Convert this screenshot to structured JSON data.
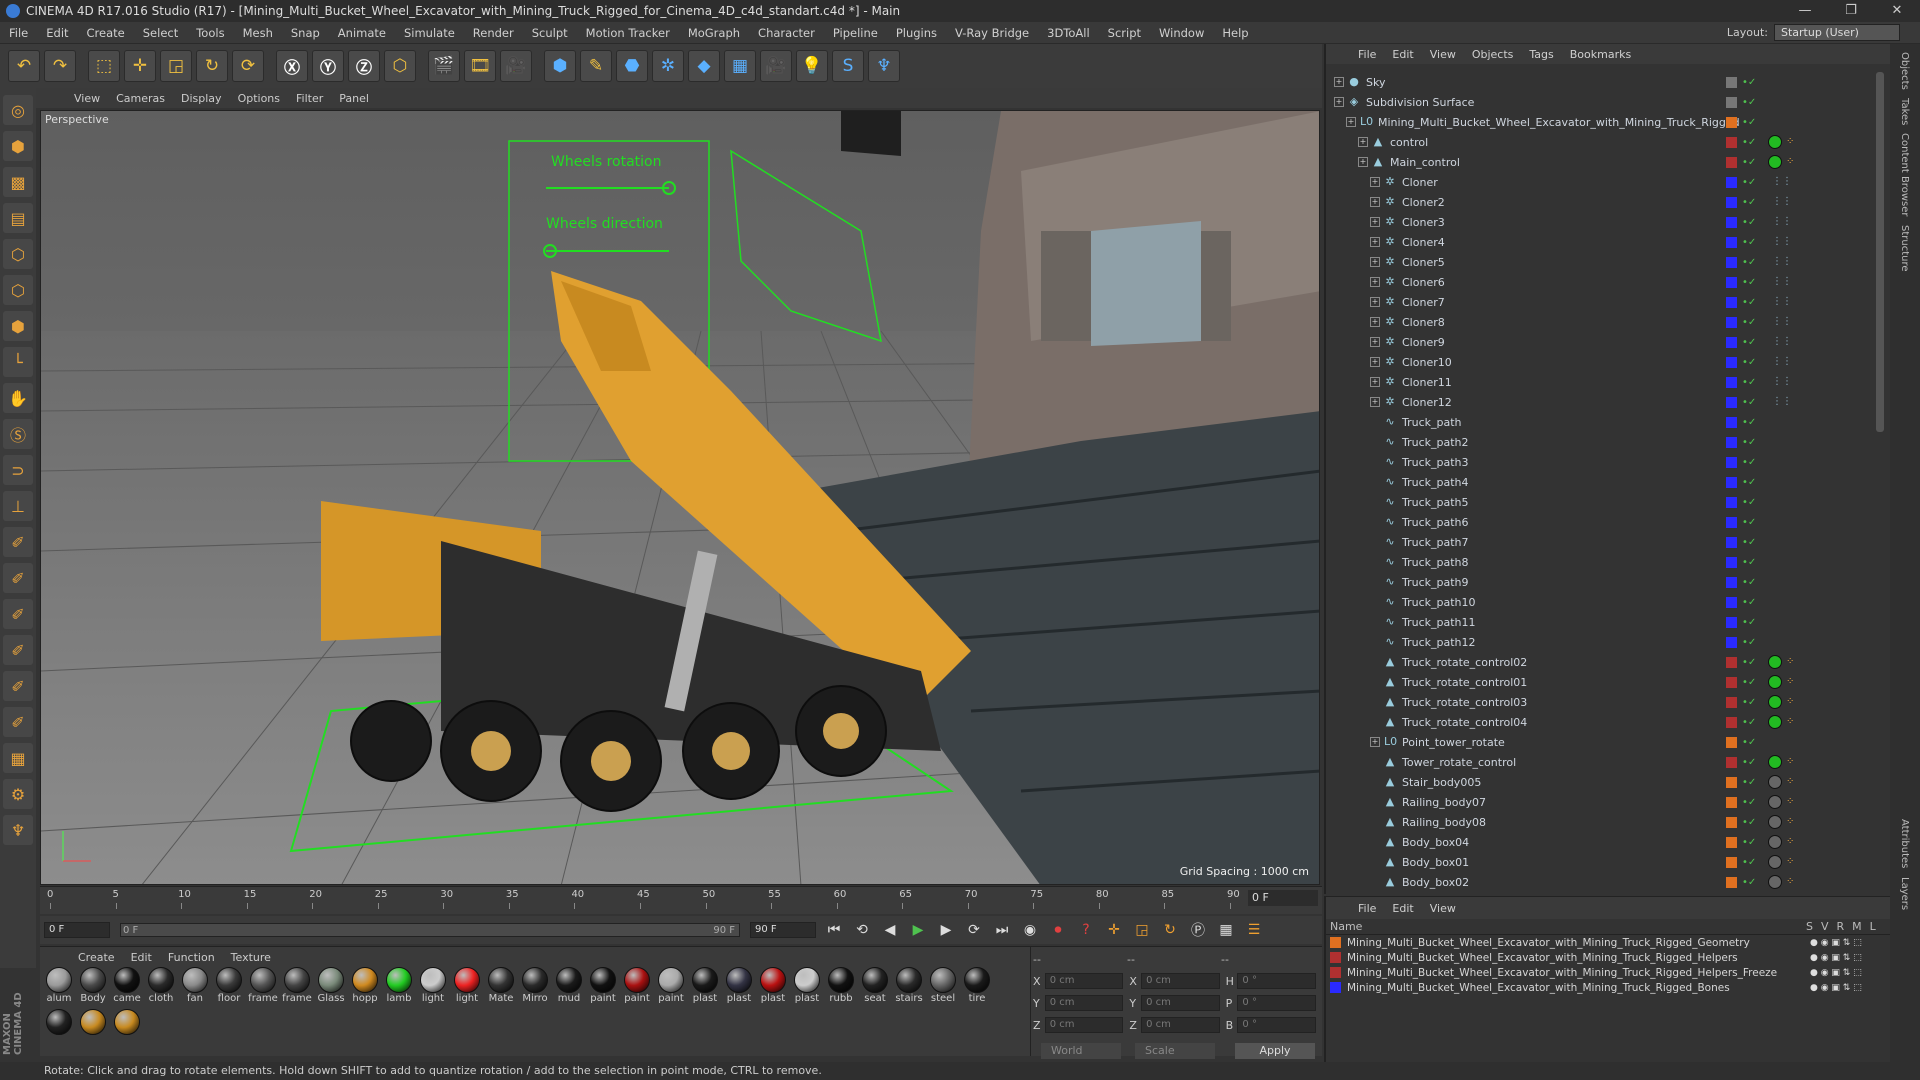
{
  "window": {
    "title": "CINEMA 4D R17.016 Studio (R17) - [Mining_Multi_Bucket_Wheel_Excavator_with_Mining_Truck_Rigged_for_Cinema_4D_c4d_standart.c4d *] - Main",
    "controls": [
      "—",
      "❐",
      "✕"
    ]
  },
  "menu": [
    "File",
    "Edit",
    "Create",
    "Select",
    "Tools",
    "Mesh",
    "Snap",
    "Animate",
    "Simulate",
    "Render",
    "Sculpt",
    "Motion Tracker",
    "MoGraph",
    "Character",
    "Pipeline",
    "Plugins",
    "V-Ray Bridge",
    "3DToAll",
    "Script",
    "Window",
    "Help"
  ],
  "layout": {
    "label": "Layout:",
    "value": "Startup (User)"
  },
  "viewport": {
    "menu": [
      "View",
      "Cameras",
      "Display",
      "Options",
      "Filter",
      "Panel"
    ],
    "label": "Perspective",
    "grid_spacing": "Grid Spacing : 1000 cm",
    "hud": [
      "Wheels rotation",
      "Wheels direction"
    ]
  },
  "timeline": {
    "ticks": [
      "0",
      "5",
      "10",
      "15",
      "20",
      "25",
      "30",
      "35",
      "40",
      "45",
      "50",
      "55",
      "60",
      "65",
      "70",
      "75",
      "80",
      "85",
      "90"
    ],
    "frame_end": "0 F"
  },
  "transport": {
    "start": "0 F",
    "scrub_start": "0 F",
    "scrub_end": "90 F",
    "end": "90 F"
  },
  "material": {
    "menu": [
      "Create",
      "Edit",
      "Function",
      "Texture"
    ],
    "items": [
      {
        "label": "alum",
        "color": "#9a9a9a"
      },
      {
        "label": "Body",
        "color": "#4a4a4a"
      },
      {
        "label": "came",
        "color": "#111111"
      },
      {
        "label": "cloth",
        "color": "#2a2a2a"
      },
      {
        "label": "fan",
        "color": "#8a8a8a"
      },
      {
        "label": "floor",
        "color": "#3a3a3a"
      },
      {
        "label": "frame",
        "color": "#555555"
      },
      {
        "label": "frame",
        "color": "#444444"
      },
      {
        "label": "Glass",
        "color": "#7a8a7a"
      },
      {
        "label": "hopp",
        "color": "#d08a20"
      },
      {
        "label": "lamb",
        "color": "#22cc22"
      },
      {
        "label": "light",
        "color": "#cccccc"
      },
      {
        "label": "light",
        "color": "#ee2222"
      },
      {
        "label": "Mate",
        "color": "#333333"
      },
      {
        "label": "Mirro",
        "color": "#2a2a2a"
      },
      {
        "label": "mud",
        "color": "#1a1a1a"
      },
      {
        "label": "paint",
        "color": "#111111"
      },
      {
        "label": "paint",
        "color": "#aa1111"
      },
      {
        "label": "paint",
        "color": "#aaaaaa"
      },
      {
        "label": "plast",
        "color": "#1a1a1a"
      },
      {
        "label": "plast",
        "color": "#333344"
      },
      {
        "label": "plast",
        "color": "#bb1111"
      },
      {
        "label": "plast",
        "color": "#cccccc"
      },
      {
        "label": "rubb",
        "color": "#111111"
      },
      {
        "label": "seat",
        "color": "#222222"
      },
      {
        "label": "stairs",
        "color": "#2a2a2a"
      },
      {
        "label": "steel",
        "color": "#666666"
      },
      {
        "label": "tire",
        "color": "#1a1a1a"
      },
      {
        "label": "",
        "color": "#222222"
      },
      {
        "label": "",
        "color": "#c88a20"
      },
      {
        "label": "",
        "color": "#c88a20"
      }
    ]
  },
  "coords": {
    "header": [
      "--",
      "--",
      "--"
    ],
    "rows": [
      {
        "a": "X",
        "v1": "0 cm",
        "b": "X",
        "v2": "0 cm",
        "c": "H",
        "v3": "0 °"
      },
      {
        "a": "Y",
        "v1": "0 cm",
        "b": "Y",
        "v2": "0 cm",
        "c": "P",
        "v3": "0 °"
      },
      {
        "a": "Z",
        "v1": "0 cm",
        "b": "Z",
        "v2": "0 cm",
        "c": "B",
        "v3": "0 °"
      }
    ],
    "mode": "World",
    "scale": "Scale",
    "apply": "Apply"
  },
  "objects": {
    "menu": [
      "File",
      "Edit",
      "View",
      "Objects",
      "Tags",
      "Bookmarks"
    ],
    "rows": [
      {
        "name": "Sky",
        "indent": 0,
        "icon": "●",
        "color": "#777",
        "tag": ""
      },
      {
        "name": "Subdivision Surface",
        "indent": 0,
        "icon": "◈",
        "color": "#777",
        "tag": ""
      },
      {
        "name": "Mining_Multi_Bucket_Wheel_Excavator_with_Mining_Truck_Rigged",
        "indent": 1,
        "icon": "L0",
        "color": "#e07020",
        "tag": ""
      },
      {
        "name": "control",
        "indent": 2,
        "icon": "▲",
        "color": "#b03030",
        "tag": "#22bb22"
      },
      {
        "name": "Main_control",
        "indent": 2,
        "icon": "▲",
        "color": "#b03030",
        "tag": "#22bb22"
      },
      {
        "name": "Cloner",
        "indent": 3,
        "icon": "✲",
        "color": "#2a2aff",
        "tag": ""
      },
      {
        "name": "Cloner2",
        "indent": 3,
        "icon": "✲",
        "color": "#2a2aff",
        "tag": ""
      },
      {
        "name": "Cloner3",
        "indent": 3,
        "icon": "✲",
        "color": "#2a2aff",
        "tag": ""
      },
      {
        "name": "Cloner4",
        "indent": 3,
        "icon": "✲",
        "color": "#2a2aff",
        "tag": ""
      },
      {
        "name": "Cloner5",
        "indent": 3,
        "icon": "✲",
        "color": "#2a2aff",
        "tag": ""
      },
      {
        "name": "Cloner6",
        "indent": 3,
        "icon": "✲",
        "color": "#2a2aff",
        "tag": ""
      },
      {
        "name": "Cloner7",
        "indent": 3,
        "icon": "✲",
        "color": "#2a2aff",
        "tag": ""
      },
      {
        "name": "Cloner8",
        "indent": 3,
        "icon": "✲",
        "color": "#2a2aff",
        "tag": ""
      },
      {
        "name": "Cloner9",
        "indent": 3,
        "icon": "✲",
        "color": "#2a2aff",
        "tag": ""
      },
      {
        "name": "Cloner10",
        "indent": 3,
        "icon": "✲",
        "color": "#2a2aff",
        "tag": ""
      },
      {
        "name": "Cloner11",
        "indent": 3,
        "icon": "✲",
        "color": "#2a2aff",
        "tag": ""
      },
      {
        "name": "Cloner12",
        "indent": 3,
        "icon": "✲",
        "color": "#2a2aff",
        "tag": ""
      },
      {
        "name": "Truck_path",
        "indent": 3,
        "icon": "∿",
        "color": "#2a2aff",
        "tag": ""
      },
      {
        "name": "Truck_path2",
        "indent": 3,
        "icon": "∿",
        "color": "#2a2aff",
        "tag": ""
      },
      {
        "name": "Truck_path3",
        "indent": 3,
        "icon": "∿",
        "color": "#2a2aff",
        "tag": ""
      },
      {
        "name": "Truck_path4",
        "indent": 3,
        "icon": "∿",
        "color": "#2a2aff",
        "tag": ""
      },
      {
        "name": "Truck_path5",
        "indent": 3,
        "icon": "∿",
        "color": "#2a2aff",
        "tag": ""
      },
      {
        "name": "Truck_path6",
        "indent": 3,
        "icon": "∿",
        "color": "#2a2aff",
        "tag": ""
      },
      {
        "name": "Truck_path7",
        "indent": 3,
        "icon": "∿",
        "color": "#2a2aff",
        "tag": ""
      },
      {
        "name": "Truck_path8",
        "indent": 3,
        "icon": "∿",
        "color": "#2a2aff",
        "tag": ""
      },
      {
        "name": "Truck_path9",
        "indent": 3,
        "icon": "∿",
        "color": "#2a2aff",
        "tag": ""
      },
      {
        "name": "Truck_path10",
        "indent": 3,
        "icon": "∿",
        "color": "#2a2aff",
        "tag": ""
      },
      {
        "name": "Truck_path11",
        "indent": 3,
        "icon": "∿",
        "color": "#2a2aff",
        "tag": ""
      },
      {
        "name": "Truck_path12",
        "indent": 3,
        "icon": "∿",
        "color": "#2a2aff",
        "tag": ""
      },
      {
        "name": "Truck_rotate_control02",
        "indent": 3,
        "icon": "▲",
        "color": "#b03030",
        "tag": "#22bb22"
      },
      {
        "name": "Truck_rotate_control01",
        "indent": 3,
        "icon": "▲",
        "color": "#b03030",
        "tag": "#22bb22"
      },
      {
        "name": "Truck_rotate_control03",
        "indent": 3,
        "icon": "▲",
        "color": "#b03030",
        "tag": "#22bb22"
      },
      {
        "name": "Truck_rotate_control04",
        "indent": 3,
        "icon": "▲",
        "color": "#b03030",
        "tag": "#22bb22"
      },
      {
        "name": "Point_tower_rotate",
        "indent": 3,
        "icon": "L0",
        "color": "#e07020",
        "tag": ""
      },
      {
        "name": "Tower_rotate_control",
        "indent": 3,
        "icon": "▲",
        "color": "#b03030",
        "tag": "#22bb22"
      },
      {
        "name": "Stair_body005",
        "indent": 3,
        "icon": "▲",
        "color": "#e07020",
        "tag": "#666"
      },
      {
        "name": "Railing_body07",
        "indent": 3,
        "icon": "▲",
        "color": "#e07020",
        "tag": "#666"
      },
      {
        "name": "Railing_body08",
        "indent": 3,
        "icon": "▲",
        "color": "#e07020",
        "tag": "#666"
      },
      {
        "name": "Body_box04",
        "indent": 3,
        "icon": "▲",
        "color": "#e07020",
        "tag": "#666"
      },
      {
        "name": "Body_box01",
        "indent": 3,
        "icon": "▲",
        "color": "#e07020",
        "tag": "#666"
      },
      {
        "name": "Body_box02",
        "indent": 3,
        "icon": "▲",
        "color": "#e07020",
        "tag": "#666"
      }
    ]
  },
  "layers": {
    "menu": [
      "File",
      "Edit",
      "View"
    ],
    "header": "Name",
    "cols": [
      "S",
      "V",
      "R",
      "M",
      "L"
    ],
    "rows": [
      {
        "name": "Mining_Multi_Bucket_Wheel_Excavator_with_Mining_Truck_Rigged_Geometry",
        "color": "#e07020"
      },
      {
        "name": "Mining_Multi_Bucket_Wheel_Excavator_with_Mining_Truck_Rigged_Helpers",
        "color": "#b03030"
      },
      {
        "name": "Mining_Multi_Bucket_Wheel_Excavator_with_Mining_Truck_Rigged_Helpers_Freeze",
        "color": "#b03030"
      },
      {
        "name": "Mining_Multi_Bucket_Wheel_Excavator_with_Mining_Truck_Rigged_Bones",
        "color": "#2a2aff"
      }
    ]
  },
  "side_tabs": [
    "Objects",
    "Takes",
    "Content Browser",
    "Structure"
  ],
  "side_tabs_bottom": [
    "Attributes",
    "Layers"
  ],
  "status": "Rotate: Click and drag to rotate elements. Hold down SHIFT to add to quantize rotation / add to the selection in point mode, CTRL to remove.",
  "brand": "MAXON CINEMA 4D"
}
